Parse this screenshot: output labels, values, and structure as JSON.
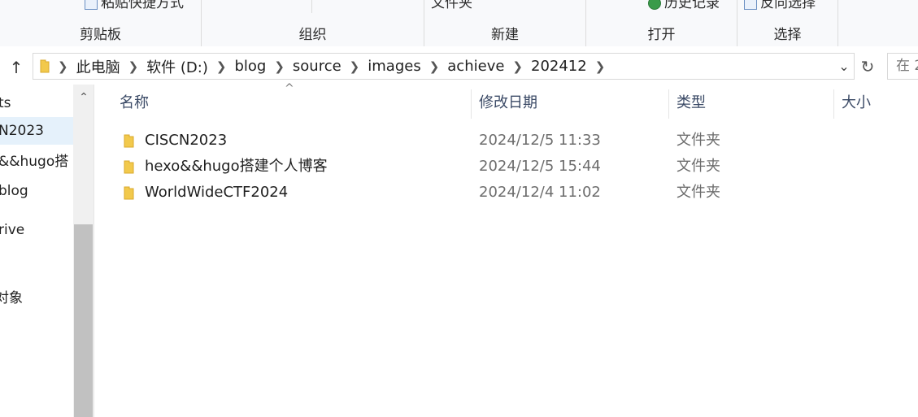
{
  "ribbon": {
    "groups": [
      {
        "label": "剪贴板"
      },
      {
        "label": "组织"
      },
      {
        "label": "新建"
      },
      {
        "label": "打开"
      },
      {
        "label": "选择"
      }
    ],
    "partial_top": {
      "clipboard_item": "粘贴快捷方式",
      "new_item": "文件夹",
      "open_item": "历史记录",
      "select_item": "反向选择"
    }
  },
  "address": {
    "crumbs": [
      "此电脑",
      "软件 (D:)",
      "blog",
      "source",
      "images",
      "achieve",
      "202412"
    ],
    "search_placeholder": "在 2"
  },
  "nav": {
    "items": [
      {
        "label": "ts"
      },
      {
        "label": "N2023"
      },
      {
        "label": "&&hugo搭"
      },
      {
        "label": "blog"
      },
      {
        "label": "rive"
      },
      {
        "label": "对象"
      }
    ]
  },
  "columns": {
    "name": "名称",
    "date": "修改日期",
    "type": "类型",
    "size": "大小"
  },
  "files": [
    {
      "name": "CISCN2023",
      "date": "2024/12/5 11:33",
      "type": "文件夹"
    },
    {
      "name": "hexo&&hugo搭建个人博客",
      "date": "2024/12/5 15:44",
      "type": "文件夹"
    },
    {
      "name": "WorldWideCTF2024",
      "date": "2024/12/4 11:02",
      "type": "文件夹"
    }
  ],
  "colors": {
    "folder_yellow": "#f2c94c",
    "selected_bg": "#e5f1fb",
    "header_text": "#3b4a66"
  }
}
